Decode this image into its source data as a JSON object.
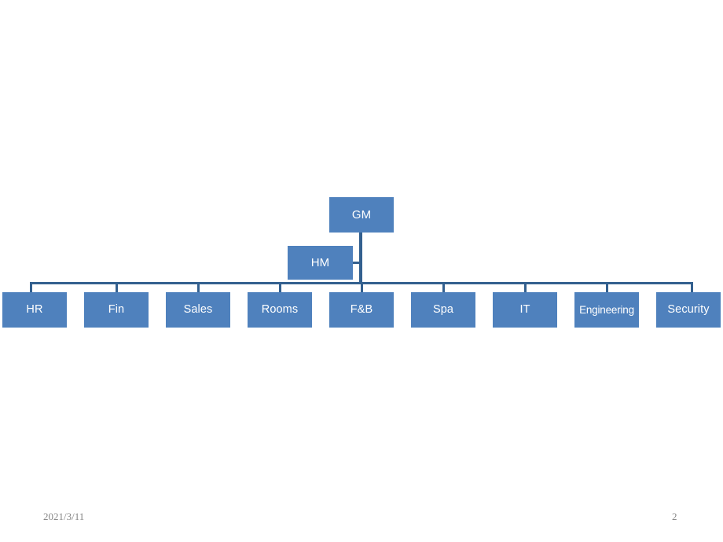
{
  "slide": {
    "background_color": "#FFFFFF",
    "node_fill_color": "#4F81BD",
    "node_text_color": "#FFFFFF",
    "connector_color": "#33608F"
  },
  "chart_data": {
    "type": "diagram",
    "diagram_kind": "organization-chart",
    "title": "",
    "nodes": [
      {
        "id": "gm",
        "label": "GM",
        "level": 0,
        "parent": null
      },
      {
        "id": "hm",
        "label": "HM",
        "level": 1,
        "parent": "gm",
        "attachment": "side"
      },
      {
        "id": "hr",
        "label": "HR",
        "level": 2,
        "parent": "gm"
      },
      {
        "id": "fin",
        "label": "Fin",
        "level": 2,
        "parent": "gm"
      },
      {
        "id": "sales",
        "label": "Sales",
        "level": 2,
        "parent": "gm"
      },
      {
        "id": "rooms",
        "label": "Rooms",
        "level": 2,
        "parent": "gm"
      },
      {
        "id": "fb",
        "label": "F&B",
        "level": 2,
        "parent": "gm"
      },
      {
        "id": "spa",
        "label": "Spa",
        "level": 2,
        "parent": "gm"
      },
      {
        "id": "it",
        "label": "IT",
        "level": 2,
        "parent": "gm"
      },
      {
        "id": "engineering",
        "label": "Engineering",
        "level": 2,
        "parent": "gm"
      },
      {
        "id": "security",
        "label": "Security",
        "level": 2,
        "parent": "gm"
      }
    ]
  },
  "org": {
    "top": {
      "label": "GM"
    },
    "assistant": {
      "label": "HM"
    },
    "departments": [
      {
        "label": "HR"
      },
      {
        "label": "Fin"
      },
      {
        "label": "Sales"
      },
      {
        "label": "Rooms"
      },
      {
        "label": "F&B"
      },
      {
        "label": "Spa"
      },
      {
        "label": "IT"
      },
      {
        "label": "Engineering"
      },
      {
        "label": "Security"
      }
    ]
  },
  "footer": {
    "date": "2021/3/11",
    "page_number": "2"
  }
}
